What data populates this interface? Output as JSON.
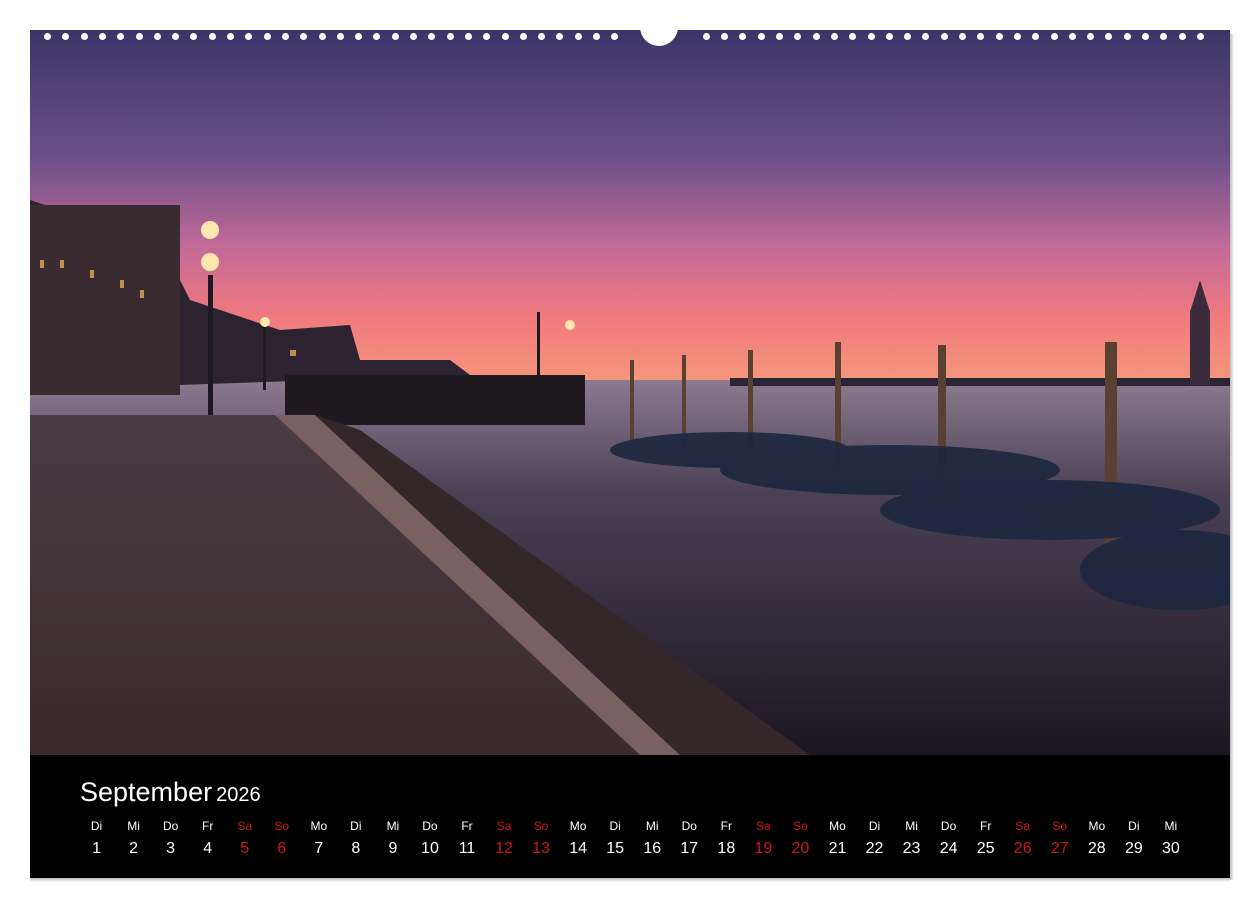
{
  "calendar": {
    "month": "September",
    "year": "2026",
    "weekend_color": "#d0141c",
    "days": [
      {
        "wd": "Di",
        "n": "1"
      },
      {
        "wd": "Mi",
        "n": "2"
      },
      {
        "wd": "Do",
        "n": "3"
      },
      {
        "wd": "Fr",
        "n": "4"
      },
      {
        "wd": "Sa",
        "n": "5",
        "we": true
      },
      {
        "wd": "So",
        "n": "6",
        "we": true
      },
      {
        "wd": "Mo",
        "n": "7"
      },
      {
        "wd": "Di",
        "n": "8"
      },
      {
        "wd": "Mi",
        "n": "9"
      },
      {
        "wd": "Do",
        "n": "10"
      },
      {
        "wd": "Fr",
        "n": "11"
      },
      {
        "wd": "Sa",
        "n": "12",
        "we": true
      },
      {
        "wd": "So",
        "n": "13",
        "we": true
      },
      {
        "wd": "Mo",
        "n": "14"
      },
      {
        "wd": "Di",
        "n": "15"
      },
      {
        "wd": "Mi",
        "n": "16"
      },
      {
        "wd": "Do",
        "n": "17"
      },
      {
        "wd": "Fr",
        "n": "18"
      },
      {
        "wd": "Sa",
        "n": "19",
        "we": true
      },
      {
        "wd": "So",
        "n": "20",
        "we": true
      },
      {
        "wd": "Mo",
        "n": "21"
      },
      {
        "wd": "Di",
        "n": "22"
      },
      {
        "wd": "Mi",
        "n": "23"
      },
      {
        "wd": "Do",
        "n": "24"
      },
      {
        "wd": "Fr",
        "n": "25"
      },
      {
        "wd": "Sa",
        "n": "26",
        "we": true
      },
      {
        "wd": "So",
        "n": "27",
        "we": true
      },
      {
        "wd": "Mo",
        "n": "28"
      },
      {
        "wd": "Di",
        "n": "29"
      },
      {
        "wd": "Mi",
        "n": "30"
      }
    ]
  }
}
